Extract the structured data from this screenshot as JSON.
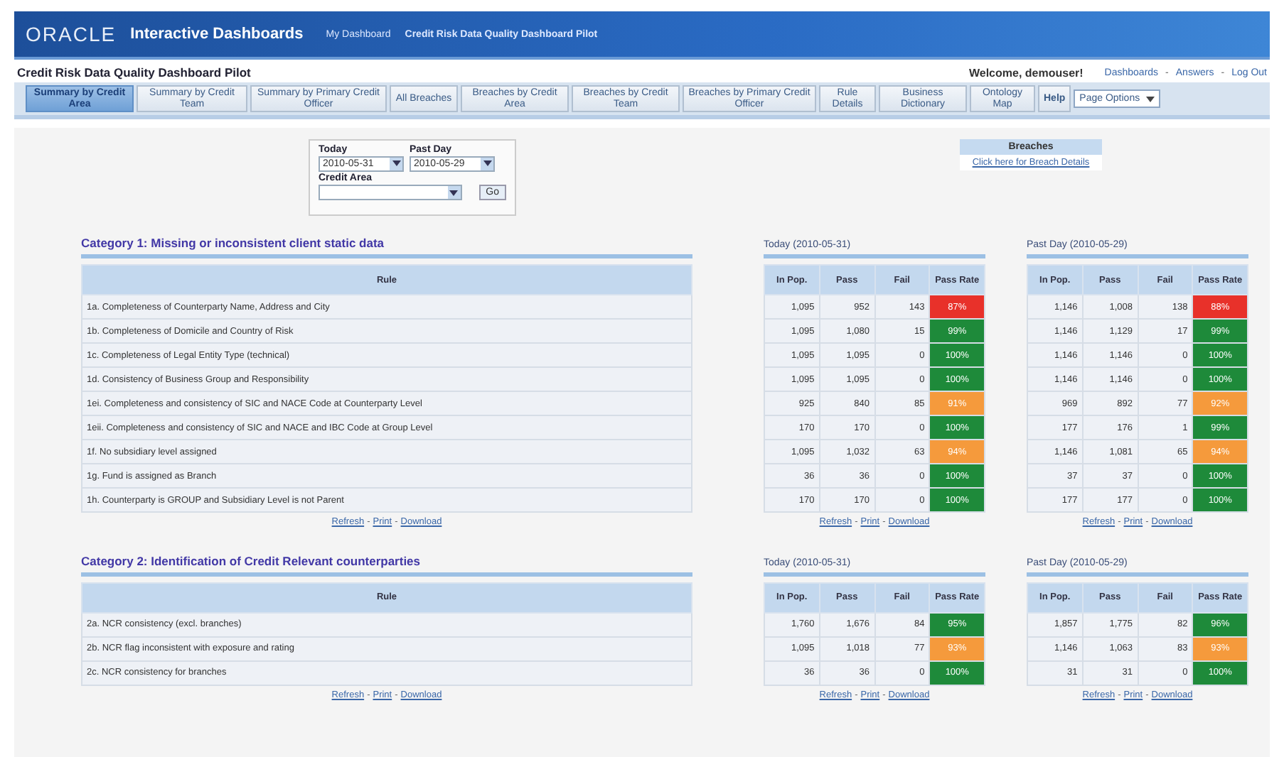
{
  "header": {
    "logo": "ORACLE",
    "product": "Interactive Dashboards",
    "nav": [
      "My Dashboard",
      "Credit Risk Data Quality Dashboard Pilot"
    ]
  },
  "subheader": {
    "title": "Credit Risk Data Quality Dashboard Pilot",
    "welcome": "Welcome, demouser!",
    "links": [
      "Dashboards",
      "Answers",
      "Log Out"
    ],
    "separator": "-"
  },
  "tabs": [
    {
      "label": "Summary by Credit Area",
      "selected": true
    },
    {
      "label": "Summary by Credit Team",
      "selected": false
    },
    {
      "label": "Summary by Primary Credit Officer",
      "selected": false
    },
    {
      "label": "All Breaches",
      "selected": false
    },
    {
      "label": "Breaches by Credit Area",
      "selected": false
    },
    {
      "label": "Breaches by Credit Team",
      "selected": false
    },
    {
      "label": "Breaches by Primary Credit Officer",
      "selected": false
    },
    {
      "label": "Rule Details",
      "selected": false
    },
    {
      "label": "Business Dictionary",
      "selected": false
    },
    {
      "label": "Ontology Map",
      "selected": false
    },
    {
      "label": "Help",
      "selected": false
    }
  ],
  "page_options": "Page Options",
  "filters": {
    "today_label": "Today",
    "today_value": "2010-05-31",
    "past_label": "Past Day",
    "past_value": "2010-05-29",
    "area_label": "Credit Area",
    "go": "Go"
  },
  "breaches": {
    "title": "Breaches",
    "link": "Click here for Breach Details"
  },
  "categories": [
    {
      "title": "Category 1: Missing or inconsistent client static data",
      "rules": {
        "header": "Rule",
        "links": [
          "Refresh",
          "Print",
          "Download"
        ],
        "rows": [
          "1a. Completeness of Counterparty Name, Address and City",
          "1b. Completeness of Domicile and Country of Risk",
          "1c. Completeness of Legal Entity Type (technical)",
          "1d. Consistency of Business Group and Responsibility",
          "1ei. Completeness and consistency of SIC and NACE Code at Counterparty Level",
          "1eii. Completeness and consistency of SIC and NACE and IBC Code at Group Level",
          "1f. No subsidiary level assigned",
          "1g. Fund is assigned as Branch",
          "1h. Counterparty is GROUP and Subsidiary Level is not Parent"
        ]
      },
      "periods": [
        {
          "title": "Today (2010-05-31)",
          "columns": [
            "In Pop.",
            "Pass",
            "Fail",
            "Pass Rate"
          ],
          "links": [
            "Refresh",
            "Print",
            "Download"
          ],
          "rows": [
            {
              "values": [
                "1,095",
                "952",
                "143"
              ],
              "rate": "87%",
              "color": "#e8312a"
            },
            {
              "values": [
                "1,095",
                "1,080",
                "15"
              ],
              "rate": "99%",
              "color": "#1e8a3a"
            },
            {
              "values": [
                "1,095",
                "1,095",
                "0"
              ],
              "rate": "100%",
              "color": "#1e8a3a"
            },
            {
              "values": [
                "1,095",
                "1,095",
                "0"
              ],
              "rate": "100%",
              "color": "#1e8a3a"
            },
            {
              "values": [
                "925",
                "840",
                "85"
              ],
              "rate": "91%",
              "color": "#f59a3c"
            },
            {
              "values": [
                "170",
                "170",
                "0"
              ],
              "rate": "100%",
              "color": "#1e8a3a"
            },
            {
              "values": [
                "1,095",
                "1,032",
                "63"
              ],
              "rate": "94%",
              "color": "#f59a3c"
            },
            {
              "values": [
                "36",
                "36",
                "0"
              ],
              "rate": "100%",
              "color": "#1e8a3a"
            },
            {
              "values": [
                "170",
                "170",
                "0"
              ],
              "rate": "100%",
              "color": "#1e8a3a"
            }
          ]
        },
        {
          "title": "Past Day (2010-05-29)",
          "columns": [
            "In Pop.",
            "Pass",
            "Fail",
            "Pass Rate"
          ],
          "links": [
            "Refresh",
            "Print",
            "Download"
          ],
          "rows": [
            {
              "values": [
                "1,146",
                "1,008",
                "138"
              ],
              "rate": "88%",
              "color": "#e8312a"
            },
            {
              "values": [
                "1,146",
                "1,129",
                "17"
              ],
              "rate": "99%",
              "color": "#1e8a3a"
            },
            {
              "values": [
                "1,146",
                "1,146",
                "0"
              ],
              "rate": "100%",
              "color": "#1e8a3a"
            },
            {
              "values": [
                "1,146",
                "1,146",
                "0"
              ],
              "rate": "100%",
              "color": "#1e8a3a"
            },
            {
              "values": [
                "969",
                "892",
                "77"
              ],
              "rate": "92%",
              "color": "#f59a3c"
            },
            {
              "values": [
                "177",
                "176",
                "1"
              ],
              "rate": "99%",
              "color": "#1e8a3a"
            },
            {
              "values": [
                "1,146",
                "1,081",
                "65"
              ],
              "rate": "94%",
              "color": "#f59a3c"
            },
            {
              "values": [
                "37",
                "37",
                "0"
              ],
              "rate": "100%",
              "color": "#1e8a3a"
            },
            {
              "values": [
                "177",
                "177",
                "0"
              ],
              "rate": "100%",
              "color": "#1e8a3a"
            }
          ]
        }
      ]
    },
    {
      "title": "Category 2: Identification of Credit Relevant counterparties",
      "rules": {
        "header": "Rule",
        "links": [
          "Refresh",
          "Print",
          "Download"
        ],
        "rows": [
          "2a. NCR consistency (excl. branches)",
          "2b. NCR flag inconsistent with exposure and rating",
          "2c. NCR consistency for branches"
        ]
      },
      "periods": [
        {
          "title": "Today (2010-05-31)",
          "columns": [
            "In Pop.",
            "Pass",
            "Fail",
            "Pass Rate"
          ],
          "links": [
            "Refresh",
            "Print",
            "Download"
          ],
          "rows": [
            {
              "values": [
                "1,760",
                "1,676",
                "84"
              ],
              "rate": "95%",
              "color": "#1e8a3a"
            },
            {
              "values": [
                "1,095",
                "1,018",
                "77"
              ],
              "rate": "93%",
              "color": "#f59a3c"
            },
            {
              "values": [
                "36",
                "36",
                "0"
              ],
              "rate": "100%",
              "color": "#1e8a3a"
            }
          ]
        },
        {
          "title": "Past Day (2010-05-29)",
          "columns": [
            "In Pop.",
            "Pass",
            "Fail",
            "Pass Rate"
          ],
          "links": [
            "Refresh",
            "Print",
            "Download"
          ],
          "rows": [
            {
              "values": [
                "1,857",
                "1,775",
                "82"
              ],
              "rate": "96%",
              "color": "#1e8a3a"
            },
            {
              "values": [
                "1,146",
                "1,063",
                "83"
              ],
              "rate": "93%",
              "color": "#f59a3c"
            },
            {
              "values": [
                "31",
                "31",
                "0"
              ],
              "rate": "100%",
              "color": "#1e8a3a"
            }
          ]
        }
      ]
    }
  ]
}
